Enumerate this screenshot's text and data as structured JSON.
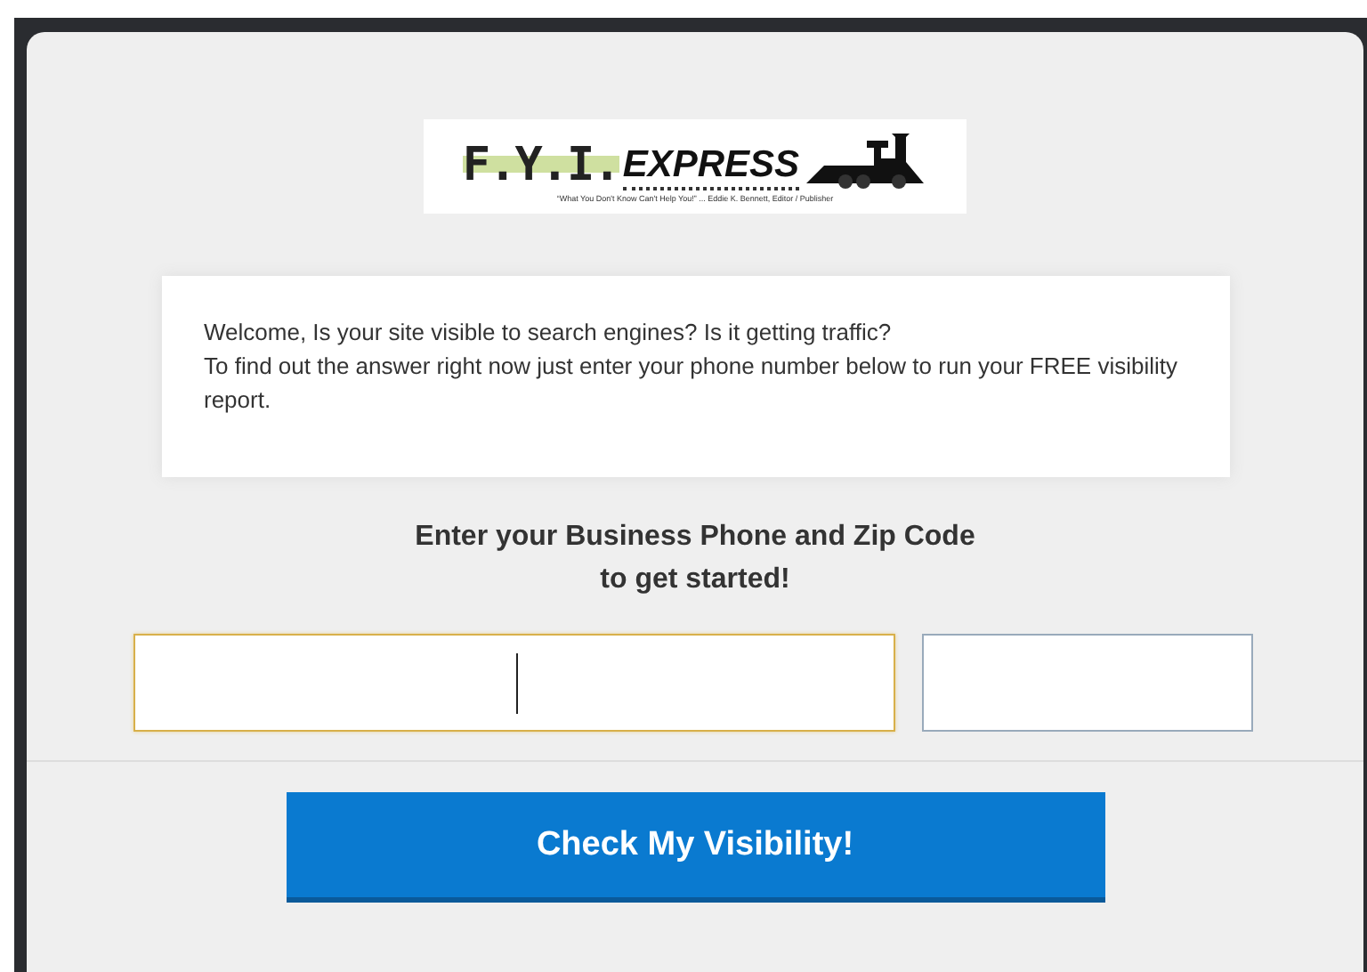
{
  "logo": {
    "letters": "F.Y.I.",
    "word": "EXPRESS",
    "tagline": "“What You Don't Know Can't Help You!” ... Eddie K. Bennett, Editor / Publisher"
  },
  "message": "Welcome, Is your site visible to search engines? Is it getting traffic?\nTo find out the answer right now just enter your phone number below to run your FREE visibility report.",
  "heading": "Enter your Business Phone and Zip Code\nto get started!",
  "fields": [
    {
      "kind": "phone",
      "focused": true
    },
    {
      "kind": "zip",
      "focused": false
    }
  ],
  "button": "Check My Visibility!"
}
